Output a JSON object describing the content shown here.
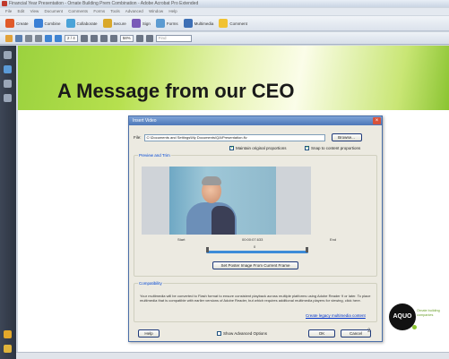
{
  "window": {
    "title": "Financial Year Presentation - Ornate Building Prem Combination - Adobe Acrobat Pro Extended"
  },
  "menubar": [
    "File",
    "Edit",
    "View",
    "Document",
    "Comments",
    "Forms",
    "Tools",
    "Advanced",
    "Window",
    "Help"
  ],
  "toolbar": {
    "create": "Create",
    "combine": "Combine",
    "collaborate": "Collaborate",
    "secure": "Secure",
    "sign": "Sign",
    "forms": "Forms",
    "multimedia": "Multimedia",
    "comment": "Comment"
  },
  "toolbar2": {
    "page": "2 / 4",
    "zoom": "58%",
    "find_placeholder": "Find"
  },
  "slide": {
    "title": "A Message from our CEO",
    "page_number": "2"
  },
  "dialog": {
    "title": "Insert Video",
    "file_label": "File:",
    "file_value": "C:\\Documents and Settings\\My Documents\\QA\\Presentation.flv",
    "browse": "Browse...",
    "chk_snap": "Snap to content proportions",
    "chk_maintain": "Maintain original proportions",
    "snap_checked": true,
    "maintain_checked": true,
    "preview_legend": "Preview and Trim",
    "time_start": "Start",
    "time_current": "00:00:07.633",
    "time_end": "End",
    "time_zero": "0",
    "set_poster": "Set Poster Image From Current Frame",
    "compat_legend": "Compatibility",
    "compat_note": "Your multimedia will be converted to Flash format to ensure consistent playback across multiple platforms using Adobe Reader 9 or later. To place multimedia that is compatible with earlier versions of Adobe Reader, but which requires additional multimedia players for viewing, click here.",
    "compat_link": "Create legacy multimedia content",
    "help": "Help",
    "show_advanced": "Show Advanced Options",
    "ok": "OK",
    "cancel": "Cancel"
  },
  "logo": {
    "text": "AQUO",
    "tagline": "Ornate building companies"
  }
}
